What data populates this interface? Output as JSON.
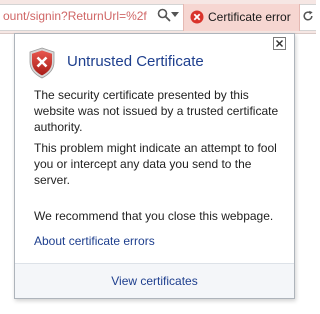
{
  "address_bar": {
    "url": "ount/signin?ReturnUrl=%2f",
    "search_icon": "search-icon",
    "dropdown_icon": "chevron-down-icon",
    "cert_error_label": "Certificate error",
    "refresh_icon": "refresh-icon"
  },
  "popup": {
    "title": "Untrusted Certificate",
    "paragraph_1": "The security certificate presented by this website was not issued by a trusted certificate authority.",
    "paragraph_2": "This problem might indicate an attempt to fool you or intercept any data you send to the server.",
    "paragraph_3": "We recommend that you close this webpage.",
    "about_link": "About certificate errors",
    "view_certificates": "View certificates",
    "close_icon": "close-icon",
    "shield_icon": "shield-error-icon"
  },
  "colors": {
    "error_red": "#d9332b",
    "link_blue": "#1e3f8e",
    "url_red": "#d06666",
    "cert_bg": "#f6d6d1"
  }
}
